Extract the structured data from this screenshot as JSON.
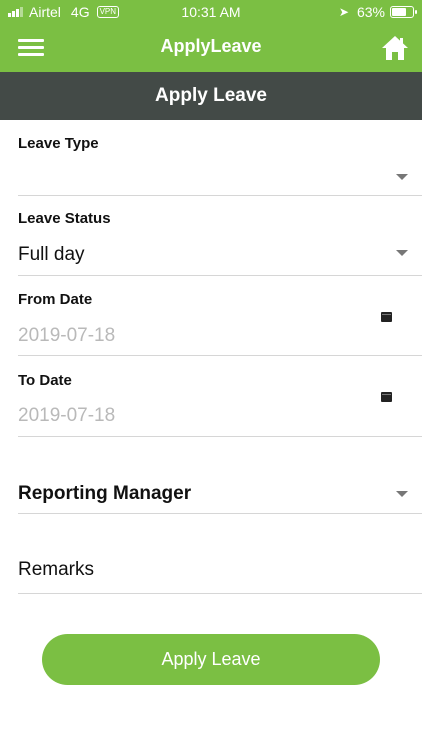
{
  "status_bar": {
    "carrier": "Airtel",
    "network": "4G",
    "vpn": "VPN",
    "time": "10:31 AM",
    "battery": "63%",
    "battery_level": 0.63
  },
  "nav_bar": {
    "title": "ApplyLeave",
    "menu_icon": "hamburger-menu-icon",
    "home_icon": "home-icon"
  },
  "page_header": {
    "title": "Apply Leave"
  },
  "form": {
    "leave_type": {
      "label": "Leave Type",
      "value": ""
    },
    "leave_status": {
      "label": "Leave Status",
      "value": "Full day"
    },
    "from_date": {
      "label": "From Date",
      "placeholder": "2019-07-18"
    },
    "to_date": {
      "label": "To Date",
      "placeholder": "2019-07-18"
    },
    "reporting_manager": {
      "label": "Reporting Manager"
    },
    "remarks": {
      "placeholder": "Remarks"
    }
  },
  "actions": {
    "apply_label": "Apply Leave"
  },
  "colors": {
    "accent": "#7bbf43",
    "header": "#434a47"
  }
}
